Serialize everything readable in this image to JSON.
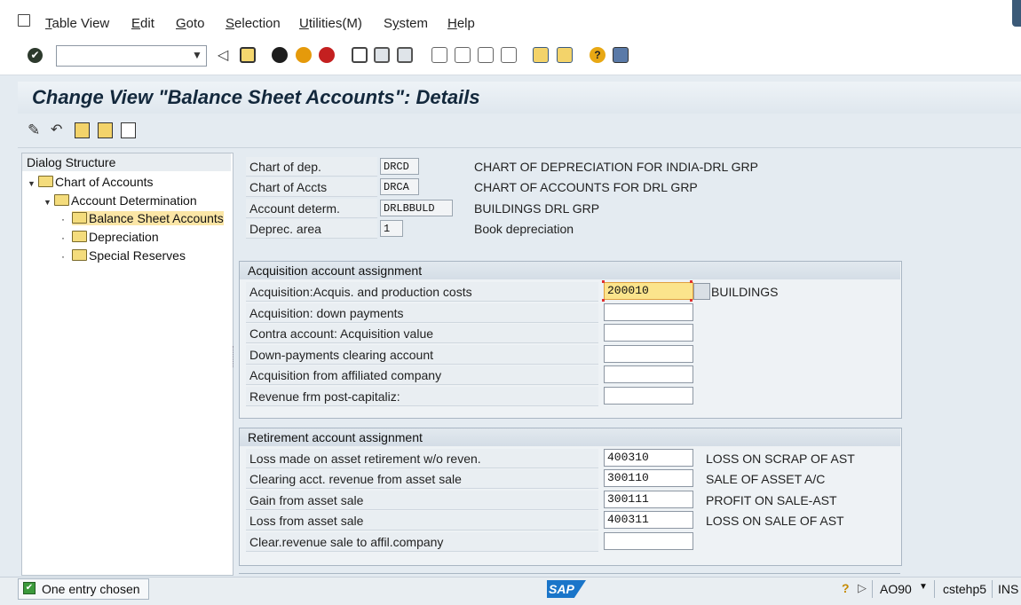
{
  "menu": [
    "Table View",
    "Edit",
    "Goto",
    "Selection",
    "Utilities(M)",
    "System",
    "Help"
  ],
  "menu_underline": [
    "T",
    "E",
    "G",
    "S",
    "U",
    "y",
    "H"
  ],
  "command_field": {
    "value": ""
  },
  "title": "Change View \"Balance Sheet Accounts\": Details",
  "tree": {
    "header": "Dialog Structure",
    "nodes": [
      "Chart of Accounts",
      "Account Determination",
      "Balance Sheet Accounts",
      "Depreciation",
      "Special Reserves"
    ]
  },
  "header_fields": [
    {
      "label": "Chart of dep.",
      "value": "DRCD",
      "desc": "CHART OF DEPRECIATION FOR INDIA-DRL GRP"
    },
    {
      "label": "Chart of Accts",
      "value": "DRCA",
      "desc": "CHART OF ACCOUNTS FOR DRL GRP"
    },
    {
      "label": "Account determ.",
      "value": "DRLBBULD",
      "desc": "BUILDINGS DRL GRP"
    },
    {
      "label": "Deprec. area",
      "value": "1",
      "desc": "Book depreciation"
    }
  ],
  "acq_group": {
    "title": "Acquisition account assignment",
    "rows": [
      {
        "label": "Acquisition:Acquis. and production costs",
        "value": "200010",
        "desc": "BUILDINGS"
      },
      {
        "label": "Acquisition: down payments",
        "value": "",
        "desc": ""
      },
      {
        "label": "Contra account: Acquisition value",
        "value": "",
        "desc": ""
      },
      {
        "label": "Down-payments clearing account",
        "value": "",
        "desc": ""
      },
      {
        "label": "Acquisition from affiliated company",
        "value": "",
        "desc": ""
      },
      {
        "label": "Revenue frm post-capitaliz:",
        "value": "",
        "desc": ""
      }
    ]
  },
  "ret_group": {
    "title": "Retirement account assignment",
    "rows": [
      {
        "label": "Loss made on asset retirement w/o reven.",
        "value": "400310",
        "desc": "LOSS ON SCRAP OF AST"
      },
      {
        "label": "Clearing acct. revenue from asset sale",
        "value": "300110",
        "desc": "SALE OF ASSET A/C"
      },
      {
        "label": "Gain from asset sale",
        "value": "300111",
        "desc": "PROFIT ON SALE-AST"
      },
      {
        "label": "Loss from asset sale",
        "value": "400311",
        "desc": "LOSS ON SALE OF AST"
      },
      {
        "label": "Clear.revenue sale to affil.company",
        "value": "",
        "desc": ""
      }
    ]
  },
  "status": {
    "message": "One entry chosen",
    "logo": "SAP",
    "transaction": "AO90",
    "server": "cstehp5",
    "mode": "INS"
  },
  "colors": {
    "accent_field": "#fbe48c",
    "selection": "#fbe6a6"
  }
}
